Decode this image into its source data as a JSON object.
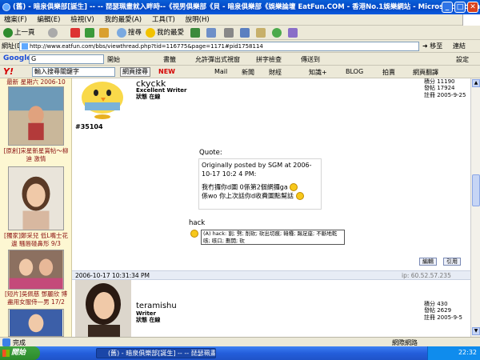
{
  "window": {
    "title": "(舊) - 暗泉俱樂部[誕生] -- -- 琵瑟珮畫就入畔時--《視男俱樂部《貝 - 暗泉俱樂部《娛樂論壇 EatFun.COM - 香港No.1娛樂網站 - Microsoft Internet Explorer"
  },
  "menu": [
    "檔案(F)",
    "編輯(E)",
    "檢視(V)",
    "我的最愛(A)",
    "工具(T)",
    "說明(H)"
  ],
  "toolbar": {
    "back": "上一頁",
    "search": "搜尋",
    "favorites": "我的最愛"
  },
  "address": {
    "label": "網址(D)",
    "url": "http://www.eatfun.com/bbs/viewthread.php?tid=116775&page=1171#pid1758114",
    "go": "移至",
    "links": "連結"
  },
  "google": {
    "logo": "Google",
    "input": "G",
    "start": "開始",
    "bookmarks": "書籤",
    "popups": "允許彈出式視窗",
    "spellcheck": "拼字檢查",
    "sendto": "傳送到",
    "settings": "設定"
  },
  "yahoo": {
    "logo": "Y!",
    "input": "輸入搜尋關鍵字",
    "search": "網頁搜尋",
    "new": "NEW",
    "mail": "Mail",
    "news": "新聞",
    "finance": "財經",
    "knowledge": "知識+",
    "blog": "BLOG",
    "auction": "拍賣",
    "translate": "網頁翻譯"
  },
  "sidebar": {
    "caption_top": "最新 星期六 2006-10",
    "caption1": "[原創]宋星新星賞帖～柳迪 激情",
    "caption2": "[獨家]鄭采兒 低L嘴士花邊 騷唇碰鼻形 9/3",
    "caption3": "[短片]吳佩慈 鄧麗欣 博 盡用女服侍—男 17/2"
  },
  "post1": {
    "username": "ckyckk",
    "rank": "Excellent Writer",
    "status": "狀態 在線",
    "stats": [
      "積分 11190",
      "發帖 17924",
      "註冊 2005-9-25"
    ],
    "post_no": "#35104",
    "quote_label": "Quote:",
    "quote_line1": "Originally posted by SGM at 2006-10-17 10:2 4 PM:",
    "quote_line2": "我冇攞你d圖 0係第2個網攞ga",
    "quote_line3": "係wo 你上次話你d收費圖點幫話",
    "reply_text": "hack",
    "tooltip": "(A) hack: 割; 劈; 削砍; 砍出切痕; 韓種; 踢足座; 不斷地乾咳; 咳口; 劃開; 砍",
    "edit": "編輯",
    "quote": "引用"
  },
  "post2": {
    "date": "2006-10-17 10:31:34 PM",
    "ip": "ip: 60.52.57.235",
    "username": "teramishu",
    "rank": "Writer",
    "status": "狀態 在線",
    "stats": [
      "積分 430",
      "發帖 2629",
      "註冊 2005-9-5"
    ]
  },
  "statusbar": {
    "text": "完成",
    "zone": "網際網路"
  },
  "taskbar": {
    "start": "開始",
    "clock": "22:32"
  }
}
